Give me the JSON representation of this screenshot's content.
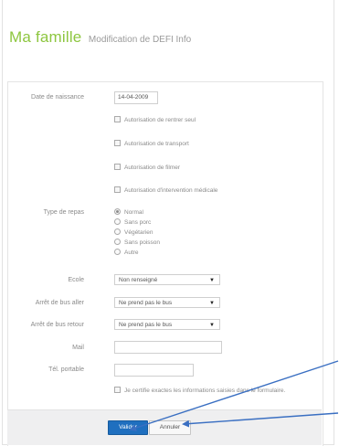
{
  "header": {
    "title": "Ma famille",
    "subtitle": "Modification de DEFI Info"
  },
  "form": {
    "birthdate_label": "Date de naissance",
    "birthdate_value": "14-04-2009",
    "checkboxes": [
      "Autorisation de rentrer seul",
      "Autorisation de transport",
      "Autorisation de filmer",
      "Autorisation d'intervention médicale"
    ],
    "meal_label": "Type de repas",
    "meal_options": [
      "Normal",
      "Sans porc",
      "Végétarien",
      "Sans poisson",
      "Autre"
    ],
    "meal_selected": "Normal",
    "school_label": "Ecole",
    "school_value": "Non renseigné",
    "bus_out_label": "Arrêt de bus aller",
    "bus_out_value": "Ne prend pas le bus",
    "bus_back_label": "Arrêt de bus retour",
    "bus_back_value": "Ne prend pas le bus",
    "mail_label": "Mail",
    "mail_value": "",
    "phone_label": "Tél. portable",
    "phone_value": "",
    "certify_text": "Je certifie exactes les informations saisies dans le formulaire."
  },
  "footer": {
    "submit_label": "Valider",
    "cancel_label": "Annuler"
  },
  "colors": {
    "title_green": "#8dc63f",
    "primary_blue": "#1f6fbf",
    "arrow_blue": "#3a6fc2"
  }
}
